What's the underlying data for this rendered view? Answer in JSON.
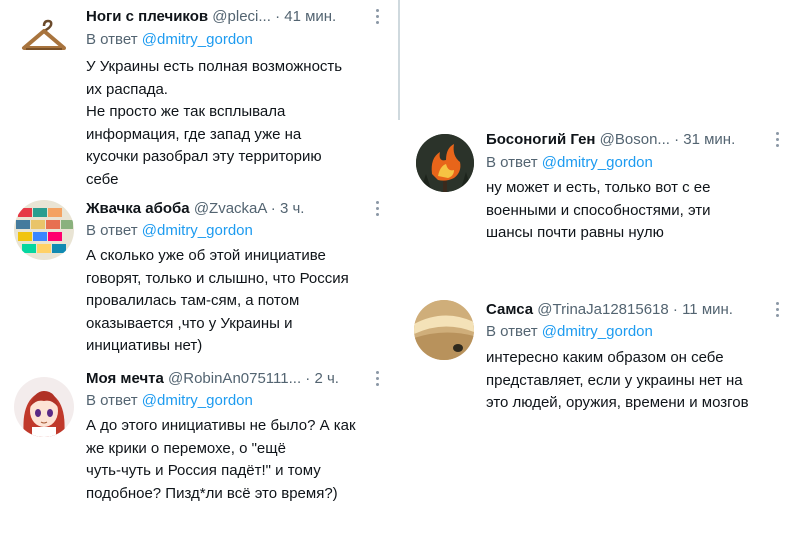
{
  "replies_to_label": "В ответ",
  "replies_to_mention": "@dmitry_gordon",
  "tweets": [
    {
      "name": "Ноги с плечиков",
      "handle": "@pleci...",
      "time": "41 мин.",
      "avatar_icon": "hanger-icon",
      "text": "У Украины есть полная возможность\nих распада.\nНе просто же так всплывала\nинформация, где запад уже на\nкусочки разобрал эту территорию\nсебе"
    },
    {
      "name": "Жвачка абоба",
      "handle": "@ZvackaA",
      "time": "3 ч.",
      "avatar_icon": "gum-packs-icon",
      "text": "А сколько уже об этой инициативе\nговорят, только  и слышно, что Россия\nпровалилась там-сям,  а потом\nоказывается ,что у Украины  и\nинициативы нет)"
    },
    {
      "name": "Моя мечта",
      "handle": "@RobinAn075111...",
      "time": "2 ч.",
      "avatar_icon": "anime-girl-icon",
      "text": "А до этого инициативы не было? А как\nже крики о перемохе, о \"ещё\nчуть-чуть и Россия падёт!\" и тому\nподобное? Пизд*ли всё это время?)"
    },
    {
      "name": "Босоногий Ген",
      "handle": "@Boson...",
      "time": "31 мин.",
      "avatar_icon": "fire-tree-icon",
      "text": "ну может и есть, только вот с ее\nвоенными и способностями, эти\nшансы почти равны нулю"
    },
    {
      "name": "Самса",
      "handle": "@TrinaJa12815618",
      "time": "11 мин.",
      "avatar_icon": "samsa-pastry-icon",
      "text": "интересно каким образом он себе\nпредставляет, если у украины нет на\nэто людей, оружия, времени и мозгов"
    }
  ],
  "colors": {
    "name": "#0f1419",
    "meta": "#536471",
    "mention": "#1d9bf0"
  }
}
